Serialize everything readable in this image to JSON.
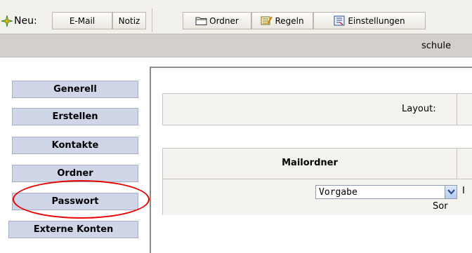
{
  "toolbar": {
    "neu_label": "Neu:",
    "new_icon": "new-sparkle-icon",
    "email_label": "E-Mail",
    "notiz_label": "Notiz",
    "ordner_label": "Ordner",
    "ordner_icon": "folder-icon",
    "regeln_label": "Regeln",
    "regeln_icon": "rules-icon",
    "einstellungen_label": "Einstellungen",
    "einstellungen_icon": "settings-icon"
  },
  "status": {
    "user_text": "schule"
  },
  "sidebar": {
    "items": [
      {
        "label": "Generell"
      },
      {
        "label": "Erstellen"
      },
      {
        "label": "Kontakte"
      },
      {
        "label": "Ordner"
      },
      {
        "label": "Passwort"
      },
      {
        "label": "Externe Konten"
      }
    ],
    "highlight_color": "#e60000"
  },
  "main": {
    "layout_label": "Layout:",
    "mailordner_header": "Mailordner",
    "select_value": "Vorgabe",
    "trailing_text_1": "I",
    "trailing_text_2": "Sor"
  },
  "colors": {
    "sidebar_button": "#cfd6e8",
    "toolbar_bg": "#f3f1ec",
    "status_strip": "#d3d0cb"
  }
}
